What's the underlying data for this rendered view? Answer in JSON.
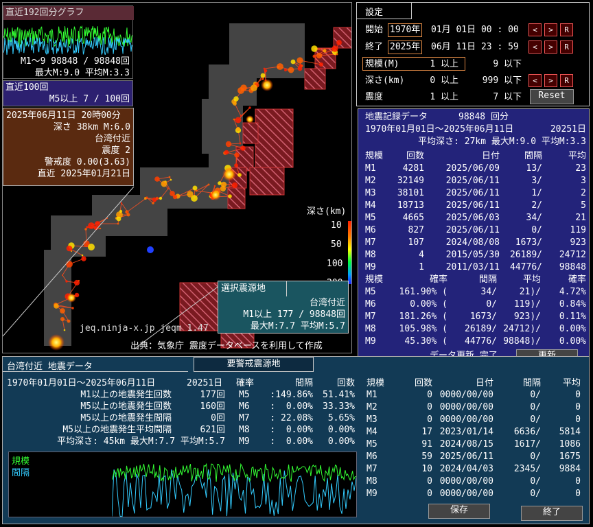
{
  "recent192": {
    "title": "直近192回分グラフ",
    "count_line": "M1〜9 98848 / 98848回",
    "stats_line": "最大M:9.0 平均M:3.3"
  },
  "recent100": {
    "title": "直近100回",
    "line": "M5以上   7 / 100回"
  },
  "event_info": {
    "datetime": "2025年06月11日 20時00分",
    "depth_mag": "深さ 38km  M:6.0",
    "place": "台湾付近",
    "intensity": "震度 2",
    "alert": "警戒度 0.00(3.63)",
    "recent": "直近 2025年01月21日"
  },
  "map": {
    "depth_label": "深さ(km)",
    "depth_ticks": [
      "10",
      "50",
      "100",
      "200"
    ],
    "credit_url": "jeq.ninja-x.jp jeqm 1.47",
    "credit_src": "出典：気象庁 震度データベースを利用して作成",
    "selected_title": "選択震源地",
    "selected_place": "台湾付近",
    "selected_line1": "M1以上   177 / 98848回",
    "selected_line2": "最大M:7.7 平均M:5.7"
  },
  "settings": {
    "title": "設定",
    "start_label": "開始",
    "start_year": "1970年",
    "start_rest": "01月 01日 00 : 00",
    "end_label": "終了",
    "end_year": "2025年",
    "end_rest": "06月 11日 23 : 59",
    "mag_label": "規模(M)",
    "mag_min": "1 以上",
    "mag_max": "9 以下",
    "depth_label": "深さ(km)",
    "depth_min": "0 以上",
    "depth_max": "999 以下",
    "int_label": "震度",
    "int_min": "1 以上",
    "int_max": "7 以下",
    "reset": "Reset",
    "arrow_left": "<",
    "arrow_right": ">",
    "arrow_r": "R"
  },
  "record": {
    "title": "地震記録データ",
    "count": "98848 回分",
    "period": "1970年01月01日〜2025年06月11日",
    "days": "20251日",
    "summary": "平均深さ: 27km 最大M:9.0 平均M:3.3",
    "headers": [
      "規模",
      "回数",
      "日付",
      "間隔",
      "平均"
    ],
    "rows": [
      [
        "M1",
        "4281",
        "2025/06/09",
        "13/",
        "23"
      ],
      [
        "M2",
        "32149",
        "2025/06/11",
        "3/",
        "3"
      ],
      [
        "M3",
        "38101",
        "2025/06/11",
        "1/",
        "2"
      ],
      [
        "M4",
        "18713",
        "2025/06/11",
        "2/",
        "5"
      ],
      [
        "M5",
        "4665",
        "2025/06/03",
        "34/",
        "21"
      ],
      [
        "M6",
        "827",
        "2025/06/11",
        "0/",
        "119"
      ],
      [
        "M7",
        "107",
        "2024/08/08",
        "1673/",
        "923"
      ],
      [
        "M8",
        "4",
        "2015/05/30",
        "26189/",
        "24712"
      ],
      [
        "M9",
        "1",
        "2011/03/11",
        "44776/",
        "98848"
      ]
    ],
    "prob_headers": [
      "規模",
      "確率",
      "間隔",
      "平均",
      "確率"
    ],
    "prob_rows": [
      [
        "M5",
        "161.90% (",
        "34/",
        "21)/",
        "4.72%"
      ],
      [
        "M6",
        "0.00% (",
        "0/",
        "119)/",
        "0.84%"
      ],
      [
        "M7",
        "181.26% (",
        "1673/",
        "923)/",
        "0.11%"
      ],
      [
        "M8",
        "105.98% (",
        "26189/",
        "24712)/",
        "0.00%"
      ],
      [
        "M9",
        "45.30% (",
        "44776/",
        "98848)/",
        "0.00%"
      ]
    ],
    "update_status": "データ更新 完了",
    "update_button": "更新"
  },
  "bottom": {
    "tab1": "台湾付近 地震データ",
    "tab2": "要警戒震源地",
    "period": "1970年01月01日〜2025年06月11日",
    "days": "20251日",
    "lines": [
      [
        "M1以上の地震発生回数",
        "177回"
      ],
      [
        "M5以上の地震発生回数",
        "160回"
      ],
      [
        "M5以上の地震発生間隔",
        "0回"
      ],
      [
        "M5以上の地震発生平均間隔",
        "621回"
      ]
    ],
    "summary": "平均深さ: 45km 最大M:7.7 平均M:5.7",
    "prob_headers": [
      "確率",
      "間隔",
      "回数"
    ],
    "prob_rows": [
      [
        "M5",
        ":149.86%",
        "51.41%"
      ],
      [
        "M6",
        ":  0.00%",
        "33.33%"
      ],
      [
        "M7",
        ": 22.08%",
        "5.65%"
      ],
      [
        "M8",
        ":  0.00%",
        "0.00%"
      ],
      [
        "M9",
        ":  0.00%",
        "0.00%"
      ]
    ],
    "legend_mag": "規模",
    "legend_int": "間隔",
    "table_headers": [
      "規模",
      "回数",
      "日付",
      "間隔",
      "平均"
    ],
    "table_rows": [
      [
        "M1",
        "0",
        "0000/00/00",
        "0/",
        "0"
      ],
      [
        "M2",
        "0",
        "0000/00/00",
        "0/",
        "0"
      ],
      [
        "M3",
        "0",
        "0000/00/00",
        "0/",
        "0"
      ],
      [
        "M4",
        "17",
        "2023/01/14",
        "6636/",
        "5814"
      ],
      [
        "M5",
        "91",
        "2024/08/15",
        "1617/",
        "1086"
      ],
      [
        "M6",
        "59",
        "2025/06/11",
        "0/",
        "1675"
      ],
      [
        "M7",
        "10",
        "2024/04/03",
        "2345/",
        "9884"
      ],
      [
        "M8",
        "0",
        "0000/00/00",
        "0/",
        "0"
      ],
      [
        "M9",
        "0",
        "0000/00/00",
        "0/",
        "0"
      ]
    ],
    "save_button": "保存",
    "exit_button": "終了"
  }
}
